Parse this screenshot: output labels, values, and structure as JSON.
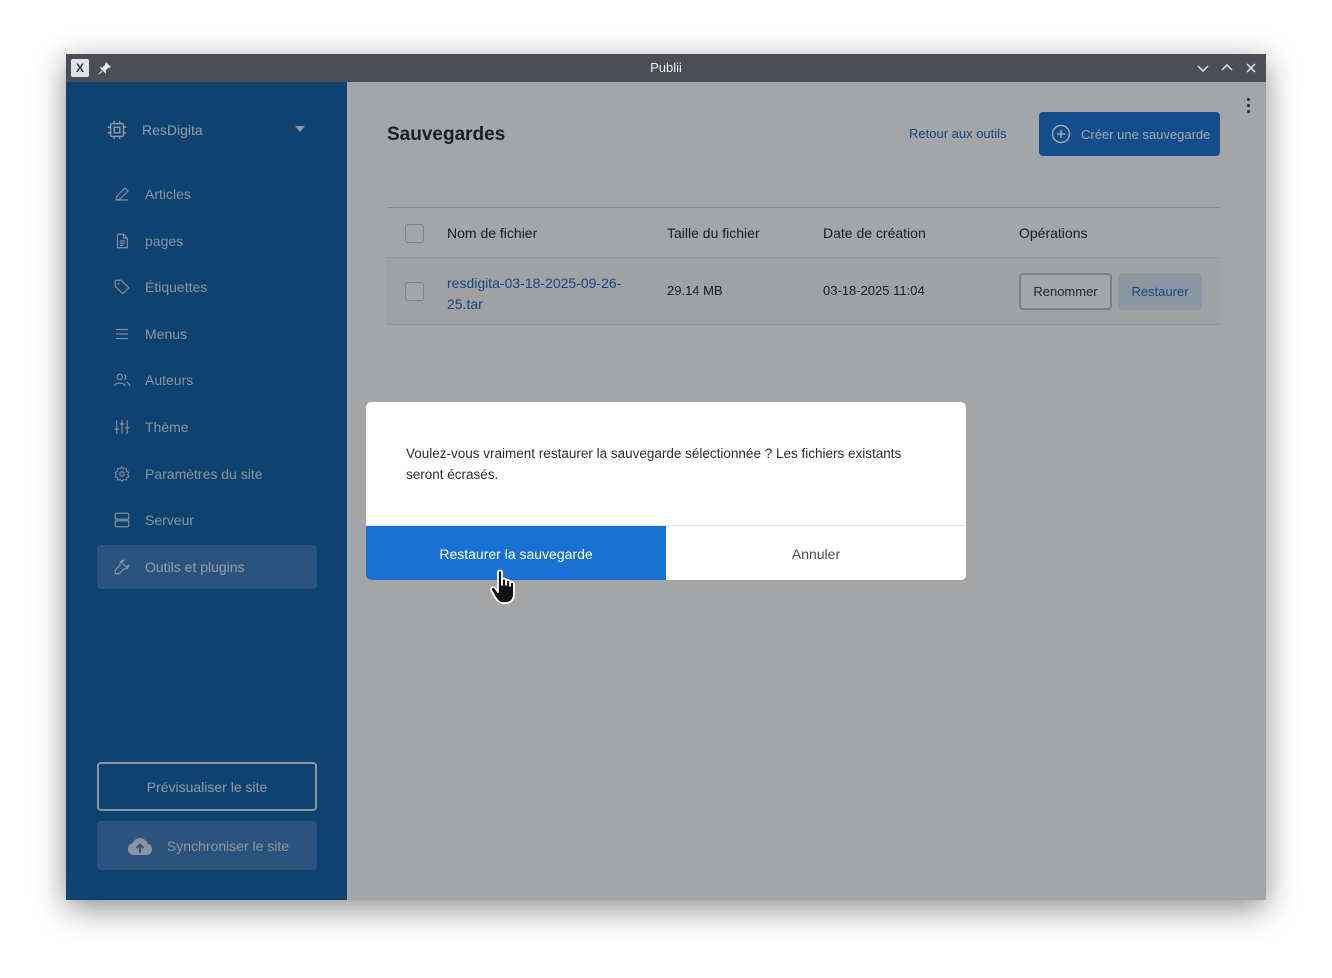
{
  "window": {
    "title": "Publii"
  },
  "sidebar": {
    "site_name": "ResDigita",
    "items": [
      {
        "label": "Articles",
        "icon": "pencil-icon"
      },
      {
        "label": "pages",
        "icon": "page-icon"
      },
      {
        "label": "Étiquettes",
        "icon": "tag-icon"
      },
      {
        "label": "Menus",
        "icon": "menu-icon"
      },
      {
        "label": "Auteurs",
        "icon": "users-icon"
      },
      {
        "label": "Thème",
        "icon": "sliders-icon"
      },
      {
        "label": "Paramètres du site",
        "icon": "gear-icon"
      },
      {
        "label": "Serveur",
        "icon": "server-icon"
      },
      {
        "label": "Outils et plugins",
        "icon": "wrench-icon",
        "active": true
      }
    ],
    "preview_label": "Prévisualiser le site",
    "sync_label": "Synchroniser le site"
  },
  "main": {
    "title": "Sauvegardes",
    "back_link": "Retour aux outils",
    "create_label": "Créer une sauvegarde",
    "table": {
      "headers": [
        "Nom de fichier",
        "Taille du fichier",
        "Date de création",
        "Opérations"
      ],
      "rows": [
        {
          "filename": "resdigita-03-18-2025-09-26-25.tar",
          "size": "29.14 MB",
          "date": "03-18-2025 11:04",
          "rename_label": "Renommer",
          "restore_label": "Restaurer"
        }
      ]
    }
  },
  "modal": {
    "message": "Voulez-vous vraiment restaurer la sauvegarde sélectionnée ? Les fichiers existants seront écrasés.",
    "confirm_label": "Restaurer la sauvegarde",
    "cancel_label": "Annuler"
  },
  "colors": {
    "sidebar": "#0e5fa8",
    "accent": "#1872d4",
    "titlebar": "#4b4f55"
  }
}
